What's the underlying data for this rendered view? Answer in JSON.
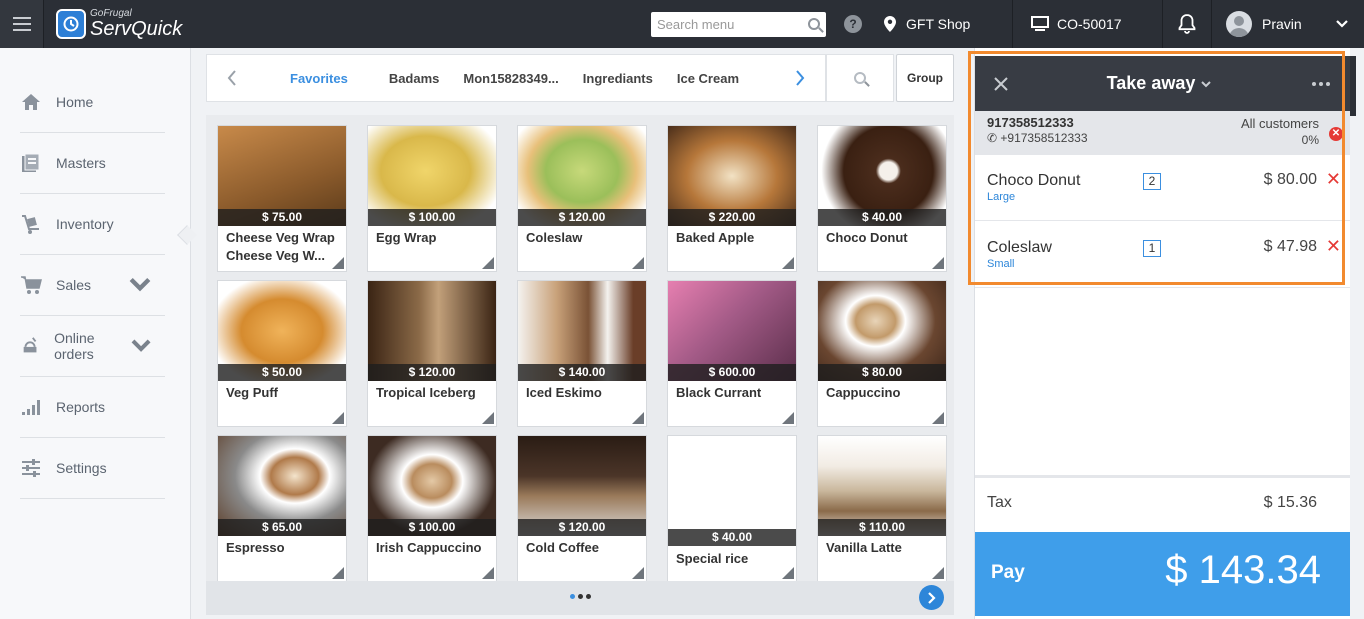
{
  "app": {
    "brand_small": "GoFrugal",
    "brand_big": "ServQuick"
  },
  "header": {
    "search_placeholder": "Search menu",
    "shop": "GFT Shop",
    "terminal": "CO-50017",
    "user": "Pravin"
  },
  "sidebar": {
    "items": [
      {
        "label": "Home",
        "icon": "home-icon"
      },
      {
        "label": "Masters",
        "icon": "masters-icon"
      },
      {
        "label": "Inventory",
        "icon": "inventory-icon"
      },
      {
        "label": "Sales",
        "icon": "cart-icon",
        "has_chevron": true
      },
      {
        "label": "Online orders",
        "icon": "online-orders-icon",
        "has_chevron": true
      },
      {
        "label": "Reports",
        "icon": "reports-icon"
      },
      {
        "label": "Settings",
        "icon": "settings-icon"
      }
    ]
  },
  "categories": {
    "tabs": [
      "Favorites",
      "Badams",
      "Mon15828349...",
      "Ingrediants",
      "Ice Cream"
    ],
    "active": "Favorites",
    "group_label": "Group"
  },
  "products": [
    {
      "name": "Cheese Veg Wrap Cheese Veg W...",
      "price": "$ 75.00",
      "color": "#8a5a2b"
    },
    {
      "name": "Egg Wrap",
      "price": "$ 100.00",
      "color": "#d9b84a"
    },
    {
      "name": "Coleslaw",
      "price": "$ 120.00",
      "color": "#9bbf5a"
    },
    {
      "name": "Baked Apple",
      "price": "$ 220.00",
      "color": "#b6773a"
    },
    {
      "name": "Choco Donut",
      "price": "$ 40.00",
      "color": "#4a2c1c"
    },
    {
      "name": "Veg Puff",
      "price": "$ 50.00",
      "color": "#d58b2f"
    },
    {
      "name": "Tropical Iceberg",
      "price": "$ 120.00",
      "color": "#8b6a48"
    },
    {
      "name": "Iced Eskimo",
      "price": "$ 140.00",
      "color": "#7a5236"
    },
    {
      "name": "Black Currant",
      "price": "$ 600.00",
      "color": "#a25a86"
    },
    {
      "name": "Cappuccino",
      "price": "$ 80.00",
      "color": "#6a4630"
    },
    {
      "name": "Espresso",
      "price": "$ 65.00",
      "color": "#5a3a24"
    },
    {
      "name": "Irish Cappuccino",
      "price": "$ 100.00",
      "color": "#3d2b22"
    },
    {
      "name": "Cold Coffee",
      "price": "$ 120.00",
      "color": "#4b3528"
    },
    {
      "name": "Special rice",
      "price": "$ 40.00",
      "color": "#ffffff"
    },
    {
      "name": "Vanilla Latte",
      "price": "$ 110.00",
      "color": "#c9b79c"
    }
  ],
  "order": {
    "type": "Take away",
    "customer_id": "917358512333",
    "customer_phone": "+917358512333",
    "customer_group": "All customers",
    "discount": "0%",
    "lines": [
      {
        "name": "Choco Donut",
        "size": "Large",
        "qty": "2",
        "price": "$ 80.00"
      },
      {
        "name": "Coleslaw",
        "size": "Small",
        "qty": "1",
        "price": "$ 47.98"
      }
    ],
    "tax_label": "Tax",
    "tax": "$ 15.36",
    "pay_label": "Pay",
    "total": "$ 143.34"
  },
  "colors": {
    "topbar": "#2b2f36",
    "accent": "#3b8fe0",
    "pay": "#3f9eea",
    "highlight": "#f28a2e",
    "delete": "#e53935"
  }
}
